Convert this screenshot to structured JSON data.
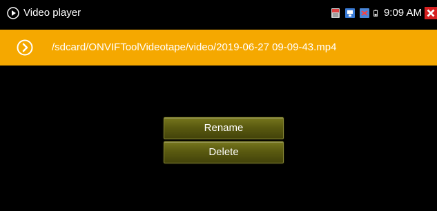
{
  "status_bar": {
    "app_title": "Video player",
    "time": "9:09 AM",
    "icons": [
      "sd-card-icon",
      "network-icon",
      "wifi-disabled-icon",
      "battery-icon",
      "close-icon"
    ]
  },
  "path_bar": {
    "path": "/sdcard/ONVIFToolVideotape/video/2019-06-27 09-09-43.mp4",
    "icon": "play-circle-icon"
  },
  "menu": {
    "rename_label": "Rename",
    "delete_label": "Delete"
  },
  "colors": {
    "background": "#000000",
    "path_bar": "#f5a800",
    "button": "#5a5a10",
    "close_red": "#d62020"
  }
}
